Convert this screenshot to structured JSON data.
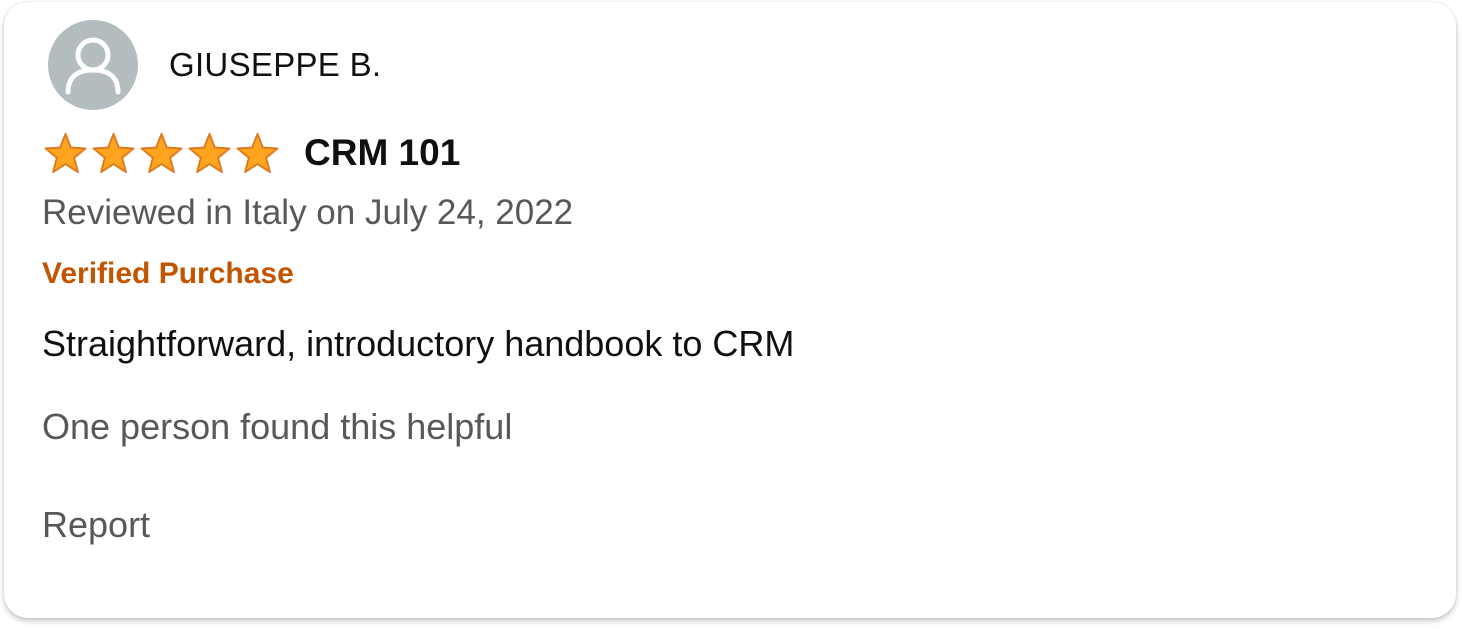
{
  "review": {
    "reviewer_name": "GIUSEPPE B.",
    "rating": 5,
    "rating_max": 5,
    "title": "CRM 101",
    "meta": "Reviewed in Italy on July 24, 2022",
    "badge": "Verified Purchase",
    "body": "Straightforward, introductory handbook to CRM",
    "helpful": "One person found this helpful",
    "report_label": "Report"
  },
  "colors": {
    "star_fill": "#ffa41c",
    "star_stroke": "#de7921",
    "verified": "#c45500",
    "muted_text": "#565959",
    "avatar_bg": "#b3bcbe"
  },
  "icons": {
    "avatar": "user-placeholder-icon",
    "star": "star-filled-icon"
  }
}
